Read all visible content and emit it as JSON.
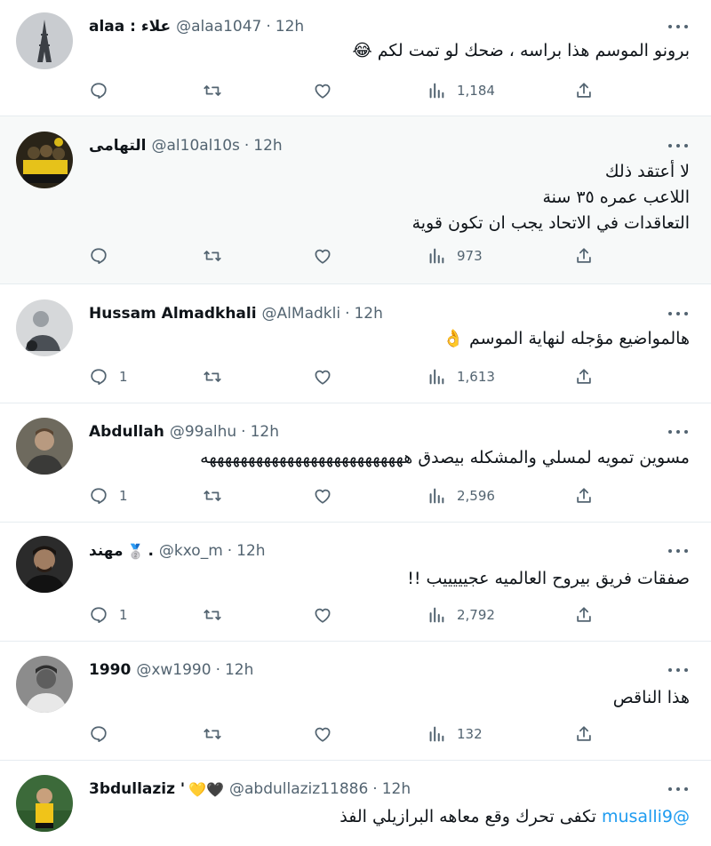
{
  "tweets": [
    {
      "name": "alaa : علاء",
      "handle": "@alaa1047",
      "time": "12h",
      "lines": [
        "برونو الموسم هذا براسه ، ضحك لو تمت لكم 😂"
      ],
      "replies": "",
      "views": "1,184",
      "highlighted": false
    },
    {
      "name": "التهامى",
      "handle": "@al10al10s",
      "time": "12h",
      "lines": [
        "لا أعتقد ذلك",
        "اللاعب عمره ٣٥ سنة",
        "التعاقدات في الاتحاد يجب ان تكون قوية"
      ],
      "replies": "",
      "views": "973",
      "highlighted": true
    },
    {
      "name": "Hussam Almadkhali",
      "handle": "@AlMadkli",
      "time": "12h",
      "lines": [
        "هالمواضيع مؤجله لنهاية الموسم 👌"
      ],
      "replies": "1",
      "views": "1,613",
      "highlighted": false
    },
    {
      "name": "Abdullah",
      "handle": "@99alhu",
      "time": "12h",
      "lines": [
        "مسوين تمويه لمسلي والمشكله بيصدق ههههههههههههههههههههههههههه"
      ],
      "replies": "1",
      "views": "2,596",
      "highlighted": false
    },
    {
      "name": "مهند",
      "name_suffix": ".",
      "badge_emoji": "🥈",
      "handle": "@kxo_m",
      "time": "12h",
      "lines": [
        "صفقات فريق بيروح العالميه عجيييييب !!"
      ],
      "replies": "1",
      "views": "2,792",
      "highlighted": false
    },
    {
      "name": "1990",
      "handle": "@xw1990",
      "time": "12h",
      "lines": [
        "هذا الناقص"
      ],
      "replies": "",
      "views": "132",
      "highlighted": false
    },
    {
      "name": "3bdullaziz '",
      "hearts": "💛🖤",
      "handle": "@abdullaziz11886",
      "time": "12h",
      "mention": "@musalli9",
      "lines": [
        "تكفى تحرك وقع معاهه البرازيلي الفذ"
      ],
      "replies": "",
      "views": "",
      "highlighted": false
    }
  ],
  "colors": {
    "secondary_text": "#536471",
    "link": "#1d9bf0",
    "divider": "#e6ecf0",
    "highlight_bg": "#f7f9f9"
  },
  "icons": [
    "reply-icon",
    "retweet-icon",
    "like-icon",
    "views-icon",
    "share-icon",
    "more-icon"
  ]
}
